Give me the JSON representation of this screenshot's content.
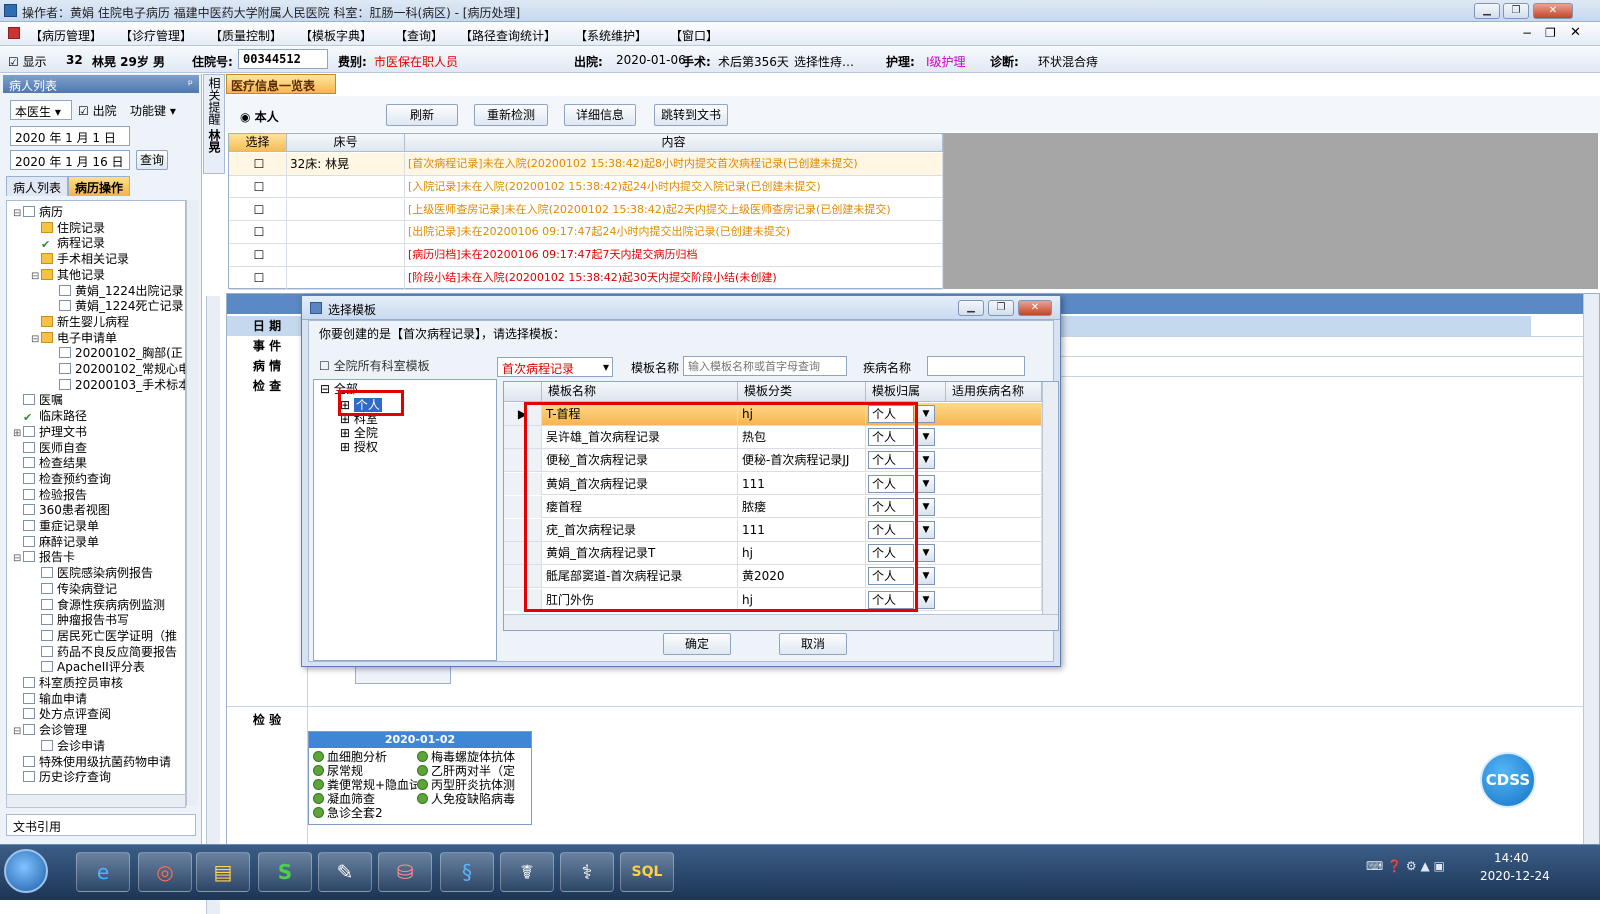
{
  "window": {
    "title": "操作者：黄娟 住院电子病历 福建中医药大学附属人民医院 科室：肛肠一科(病区) - [病历处理]"
  },
  "menu": [
    "【病历管理】",
    "【诊疗管理】",
    "【质量控制】",
    "【模板字典】",
    "【查询】",
    "【路径查询统计】",
    "【系统维护】",
    "【窗口】"
  ],
  "info": {
    "show_label": "显示",
    "bed_no": "32",
    "patient": "林晃 29岁 男",
    "admit_no_label": "住院号:",
    "admit_no": "00344512",
    "fee_label": "费别:",
    "fee": "市医保在职人员",
    "discharge_label": "出院:",
    "discharge_date": "2020-01-06",
    "surgery_label": "手术:",
    "surgery": "术后第356天",
    "surgery_choose": "选择性痔…",
    "nursing_label": "护理:",
    "nursing": "Ⅰ级护理",
    "diagnosis_label": "诊断:",
    "diagnosis": "环状混合痔"
  },
  "left": {
    "panel_title": "病人列表",
    "doctor_combo": "本医生",
    "discharged_label": "出院",
    "function_key": "功能键",
    "date_from": "2020 年 1 月 1 日",
    "date_to": "2020 年 1 月 16 日",
    "query_btn": "查询",
    "tabs": [
      "病人列表",
      "病历操作"
    ],
    "footer": "文书引用",
    "tree": [
      {
        "t": "病历",
        "lvl": 0,
        "ic": "doc",
        "exp": "−"
      },
      {
        "t": "住院记录",
        "lvl": 1,
        "ic": "folder"
      },
      {
        "t": "病程记录",
        "lvl": 1,
        "ic": "check"
      },
      {
        "t": "手术相关记录",
        "lvl": 1,
        "ic": "folder"
      },
      {
        "t": "其他记录",
        "lvl": 1,
        "ic": "folder",
        "exp": "−"
      },
      {
        "t": "黄娟_1224出院记录",
        "lvl": 2,
        "ic": "doc"
      },
      {
        "t": "黄娟_1224死亡记录",
        "lvl": 2,
        "ic": "doc"
      },
      {
        "t": "新生婴儿病程",
        "lvl": 1,
        "ic": "folder"
      },
      {
        "t": "电子申请单",
        "lvl": 1,
        "ic": "folder",
        "exp": "−"
      },
      {
        "t": "20200102_胸部(正",
        "lvl": 2,
        "ic": "doc"
      },
      {
        "t": "20200102_常规心电",
        "lvl": 2,
        "ic": "doc"
      },
      {
        "t": "20200103_手术标本",
        "lvl": 2,
        "ic": "doc"
      },
      {
        "t": "医嘱",
        "lvl": 0,
        "ic": "doc"
      },
      {
        "t": "临床路径",
        "lvl": 0,
        "ic": "check"
      },
      {
        "t": "护理文书",
        "lvl": 0,
        "ic": "doc",
        "exp": "+"
      },
      {
        "t": "医师自查",
        "lvl": 0,
        "ic": "doc"
      },
      {
        "t": "检查结果",
        "lvl": 0,
        "ic": "doc"
      },
      {
        "t": "检查预约查询",
        "lvl": 0,
        "ic": "doc"
      },
      {
        "t": "检验报告",
        "lvl": 0,
        "ic": "doc"
      },
      {
        "t": "360患者视图",
        "lvl": 0,
        "ic": "doc"
      },
      {
        "t": "重症记录单",
        "lvl": 0,
        "ic": "doc"
      },
      {
        "t": "麻醉记录单",
        "lvl": 0,
        "ic": "doc"
      },
      {
        "t": "报告卡",
        "lvl": 0,
        "ic": "doc",
        "exp": "−"
      },
      {
        "t": "医院感染病例报告",
        "lvl": 1,
        "ic": "doc"
      },
      {
        "t": "传染病登记",
        "lvl": 1,
        "ic": "doc"
      },
      {
        "t": "食源性疾病病例监测",
        "lvl": 1,
        "ic": "doc"
      },
      {
        "t": "肿瘤报告书写",
        "lvl": 1,
        "ic": "doc"
      },
      {
        "t": "居民死亡医学证明（推",
        "lvl": 1,
        "ic": "doc"
      },
      {
        "t": "药品不良反应简要报告",
        "lvl": 1,
        "ic": "doc"
      },
      {
        "t": "ApacheII评分表",
        "lvl": 1,
        "ic": "doc"
      },
      {
        "t": "科室质控员审核",
        "lvl": 0,
        "ic": "doc"
      },
      {
        "t": "输血申请",
        "lvl": 0,
        "ic": "doc"
      },
      {
        "t": "处方点评查阅",
        "lvl": 0,
        "ic": "doc"
      },
      {
        "t": "会诊管理",
        "lvl": 0,
        "ic": "doc",
        "exp": "−"
      },
      {
        "t": "会诊申请",
        "lvl": 1,
        "ic": "doc"
      },
      {
        "t": "特殊使用级抗菌药物申请",
        "lvl": 0,
        "ic": "doc"
      },
      {
        "t": "历史诊疗查询",
        "lvl": 0,
        "ic": "doc"
      }
    ]
  },
  "side_strip": {
    "top": "相关提醒",
    "name": "林晃"
  },
  "main": {
    "tab": "医疗信息一览表",
    "radio_self": "本人",
    "buttons": [
      "刷新",
      "重新检测",
      "详细信息",
      "跳转到文书"
    ],
    "headers": [
      "选择",
      "床号",
      "内容"
    ],
    "rows": [
      {
        "bed": "32床: 林晃",
        "text": "[首次病程记录]未在入院(20200102  15:38:42)起8小时内提交首次病程记录(已创建未提交)",
        "color": "#e08a00"
      },
      {
        "bed": "",
        "text": "[入院记录]未在入院(20200102  15:38:42)起24小时内提交入院记录(已创建未提交)",
        "color": "#e08a00"
      },
      {
        "bed": "",
        "text": "[上级医师查房记录]未在入院(20200102  15:38:42)起2天内提交上级医师查房记录(已创建未提交)",
        "color": "#e08a00"
      },
      {
        "bed": "",
        "text": "[出院记录]未在20200106  09:17:47起24小时内提交出院记录(已创建未提交)",
        "color": "#e08a00"
      },
      {
        "bed": "",
        "text": "[病历归档]未在20200106  09:17:47起7天内提交病历归档",
        "color": "#e00000"
      },
      {
        "bed": "",
        "text": "[阶段小结]未在入院(20200102  15:38:42)起30天内提交阶段小结(未创建)",
        "color": "#e00000"
      }
    ],
    "lower_labels": [
      "日  期",
      "事  件",
      "病  情",
      "检  查",
      "检  验"
    ],
    "exam_date": "2020-01-02",
    "exam_items_left": [
      "血细胞分析",
      "尿常规",
      "粪便常规+隐血试",
      "凝血筛查",
      "急诊全套2"
    ],
    "exam_items_right": [
      "梅毒螺旋体抗体",
      "乙肝两对半（定",
      "丙型肝炎抗体测",
      "人免疫缺陷病毒"
    ]
  },
  "dialog": {
    "title": "选择模板",
    "prompt": "你要创建的是【首次病程记录】，请选择模板：",
    "all_dept_label": "全院所有科室模板",
    "type_combo": "首次病程记录",
    "name_label": "模板名称",
    "name_placeholder": "输入模板名称或首字母查询",
    "disease_label": "疾病名称",
    "tree": [
      "全部",
      "个人",
      "科室",
      "全院",
      "授权"
    ],
    "headers": [
      "模板名称",
      "模板分类",
      "模板归属",
      "适用疾病名称"
    ],
    "rows": [
      {
        "name": "T-首程",
        "cat": "hj",
        "own": "个人"
      },
      {
        "name": "吴许雄_首次病程记录",
        "cat": "热包",
        "own": "个人"
      },
      {
        "name": "便秘_首次病程记录",
        "cat": "便秘-首次病程记录JJ",
        "own": "个人"
      },
      {
        "name": "黄娟_首次病程记录",
        "cat": "111",
        "own": "个人"
      },
      {
        "name": "瘘首程",
        "cat": "脓瘘",
        "own": "个人"
      },
      {
        "name": "疣_首次病程记录",
        "cat": "111",
        "own": "个人"
      },
      {
        "name": "黄娟_首次病程记录T",
        "cat": "hj",
        "own": "个人"
      },
      {
        "name": "骶尾部窦道-首次病程记录",
        "cat": "黄2020",
        "own": "个人"
      },
      {
        "name": "肛门外伤",
        "cat": "hj",
        "own": "个人"
      }
    ],
    "ok": "确定",
    "cancel": "取消"
  },
  "cdss": "CDSS",
  "taskbar": {
    "time": "14:40",
    "date": "2020-12-24"
  }
}
